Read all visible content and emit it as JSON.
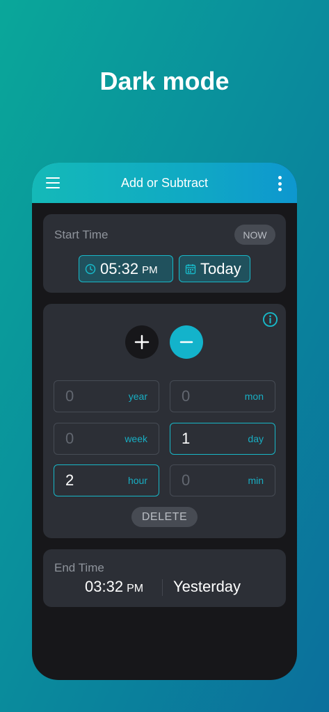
{
  "headline": "Dark mode",
  "appbar": {
    "title": "Add or Subtract",
    "menu_icon": "hamburger-menu-icon",
    "more_icon": "more-vertical-icon"
  },
  "start": {
    "label": "Start Time",
    "now_label": "NOW",
    "time": "05:32",
    "ampm": "PM",
    "date": "Today",
    "time_icon": "clock-icon",
    "date_icon": "calendar-icon"
  },
  "operation": {
    "info_icon": "info-icon",
    "plus": "+",
    "minus": "−",
    "selected": "minus"
  },
  "fields": {
    "year": {
      "value": "0",
      "unit": "year"
    },
    "mon": {
      "value": "0",
      "unit": "mon"
    },
    "week": {
      "value": "0",
      "unit": "week"
    },
    "day": {
      "value": "1",
      "unit": "day"
    },
    "hour": {
      "value": "2",
      "unit": "hour"
    },
    "min": {
      "value": "0",
      "unit": "min"
    }
  },
  "delete_label": "DELETE",
  "end": {
    "label": "End Time",
    "time": "03:32",
    "ampm": "PM",
    "date": "Yesterday"
  },
  "colors": {
    "accent": "#13b3cb",
    "card": "#2c2f36",
    "screen": "#17171a"
  }
}
